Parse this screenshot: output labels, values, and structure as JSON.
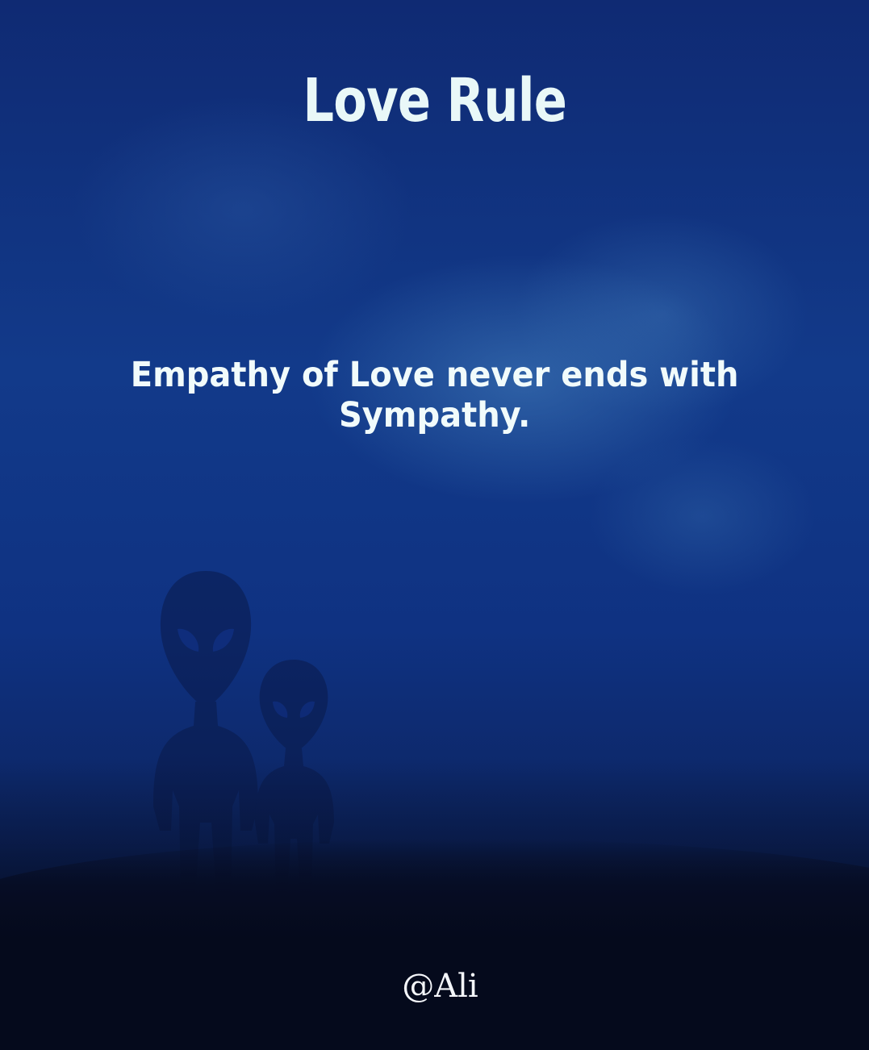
{
  "title": "Love Rule",
  "quote": "Empathy of Love never ends with Sympathy.",
  "signature": "@Ali",
  "colors": {
    "background_top": "#0f2a73",
    "background_bottom": "#04081a",
    "text": "#e9f8f8",
    "silhouette": "#0a1a4a"
  },
  "illustration": {
    "subjects": [
      "alien-silhouette-large",
      "alien-silhouette-small"
    ]
  }
}
